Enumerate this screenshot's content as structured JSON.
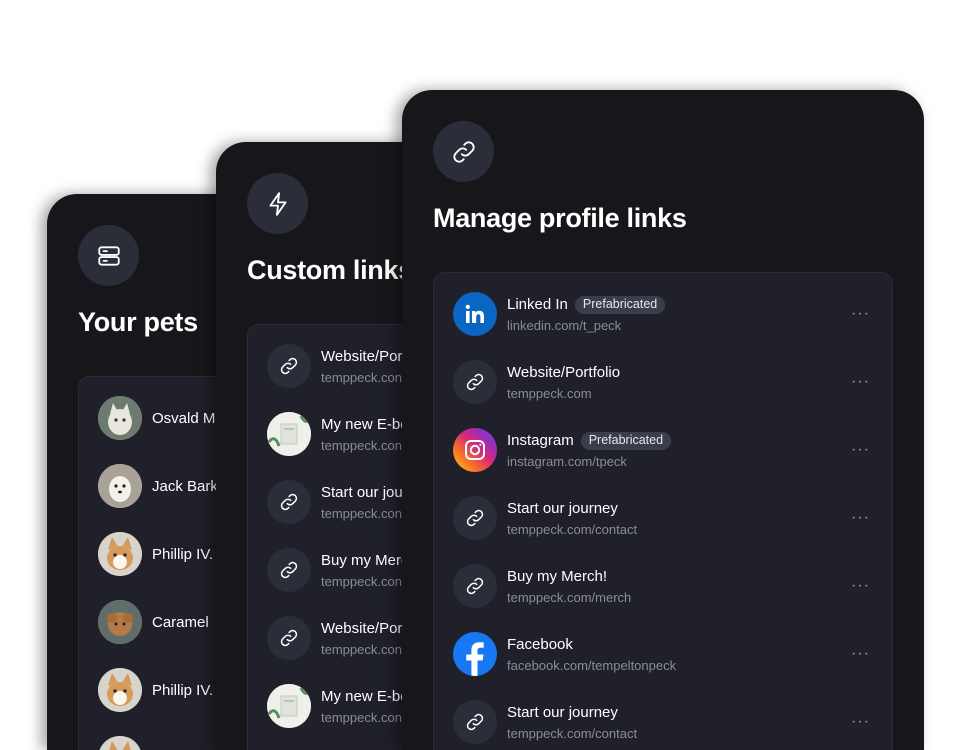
{
  "pets_card": {
    "title": "Your pets",
    "icon": "server-icon",
    "pets": [
      {
        "name": "Osvald M",
        "avatar": "cat-photo"
      },
      {
        "name": "Jack Bark",
        "avatar": "dog-photo"
      },
      {
        "name": "Phillip IV.",
        "avatar": "corgi-photo"
      },
      {
        "name": "Caramel",
        "avatar": "poodle-photo"
      },
      {
        "name": "Phillip IV.",
        "avatar": "corgi-photo"
      }
    ]
  },
  "custom_card": {
    "title": "Custom links",
    "icon": "lightning-icon",
    "links": [
      {
        "title": "Website/Por",
        "url": "temppeck.con",
        "icon": "link-icon"
      },
      {
        "title": "My new E-bo",
        "url": "temppeck.con",
        "icon": "ebook-cover"
      },
      {
        "title": "Start our jou",
        "url": "temppeck.con",
        "icon": "link-icon"
      },
      {
        "title": "Buy my Merc",
        "url": "temppeck.con",
        "icon": "link-icon"
      },
      {
        "title": "Website/Por",
        "url": "temppeck.con",
        "icon": "link-icon"
      },
      {
        "title": "My new E-bo",
        "url": "temppeck.con",
        "icon": "ebook-cover"
      }
    ]
  },
  "manage_card": {
    "title": "Manage profile links",
    "icon": "link-icon",
    "links": [
      {
        "title": "Linked In",
        "badge": "Prefabricated",
        "url": "linkedin.com/t_peck",
        "icon": "linkedin-icon"
      },
      {
        "title": "Website/Portfolio",
        "badge": "",
        "url": "temppeck.com",
        "icon": "link-icon"
      },
      {
        "title": "Instagram",
        "badge": "Prefabricated",
        "url": "instagram.com/tpeck",
        "icon": "instagram-icon"
      },
      {
        "title": "Start our journey",
        "badge": "",
        "url": "temppeck.com/contact",
        "icon": "link-icon"
      },
      {
        "title": "Buy my Merch!",
        "badge": "",
        "url": "temppeck.com/merch",
        "icon": "link-icon"
      },
      {
        "title": "Facebook",
        "badge": "",
        "url": "facebook.com/tempeltonpeck",
        "icon": "facebook-icon"
      },
      {
        "title": "Start our journey",
        "badge": "",
        "url": "temppeck.com/contact",
        "icon": "link-icon"
      }
    ],
    "more_label": "···"
  },
  "colors": {
    "card_bg": "#17171b",
    "list_bg": "#1f2029",
    "icon_bg": "#2b2d38",
    "muted_text": "#8a8c98",
    "badge_bg": "#3b3d4a",
    "linkedin": "#0a66c2",
    "facebook": "#1877f2"
  }
}
